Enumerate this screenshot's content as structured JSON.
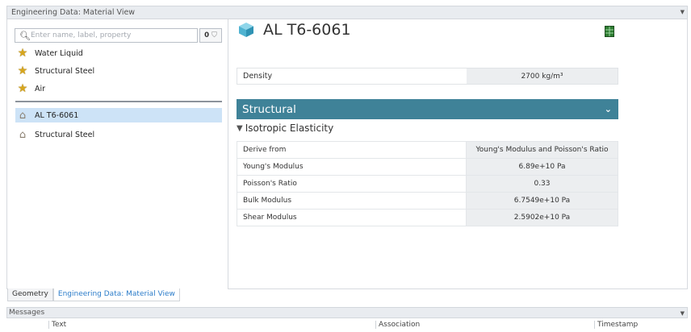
{
  "panel": {
    "title": "Engineering Data: Material View"
  },
  "search": {
    "placeholder": "Enter name, label, property",
    "filter_count": "0"
  },
  "favorites": [
    {
      "label": "Water Liquid",
      "icon": "star-icon"
    },
    {
      "label": "Structural Steel",
      "icon": "star-icon"
    },
    {
      "label": "Air",
      "icon": "star-icon"
    }
  ],
  "project_materials": [
    {
      "label": "AL T6-6061",
      "icon": "tag-icon",
      "selected": true
    },
    {
      "label": "Structural Steel",
      "icon": "tag-icon",
      "selected": false
    }
  ],
  "tabs": [
    {
      "label": "Geometry",
      "active": false
    },
    {
      "label": "Engineering Data: Material View",
      "active": true
    }
  ],
  "material": {
    "name": "AL T6-6061",
    "density": {
      "label": "Density",
      "value": "2700  kg/m³"
    }
  },
  "section": {
    "title": "Structural",
    "subsection": "Isotropic Elasticity",
    "rows": [
      {
        "label": "Derive from",
        "value": "Young's Modulus and Poisson's Ratio"
      },
      {
        "label": "Young's Modulus",
        "value": "6.89e+10  Pa"
      },
      {
        "label": "Poisson's Ratio",
        "value": "0.33"
      },
      {
        "label": "Bulk Modulus",
        "value": "6.7549e+10  Pa"
      },
      {
        "label": "Shear Modulus",
        "value": "2.5902e+10  Pa"
      }
    ]
  },
  "messages": {
    "title": "Messages",
    "columns": [
      "Text",
      "Association",
      "Timestamp"
    ]
  },
  "colors": {
    "section_header": "#3f8298",
    "selection": "#cde3f7",
    "accent_tab": "#2b7cc9"
  }
}
